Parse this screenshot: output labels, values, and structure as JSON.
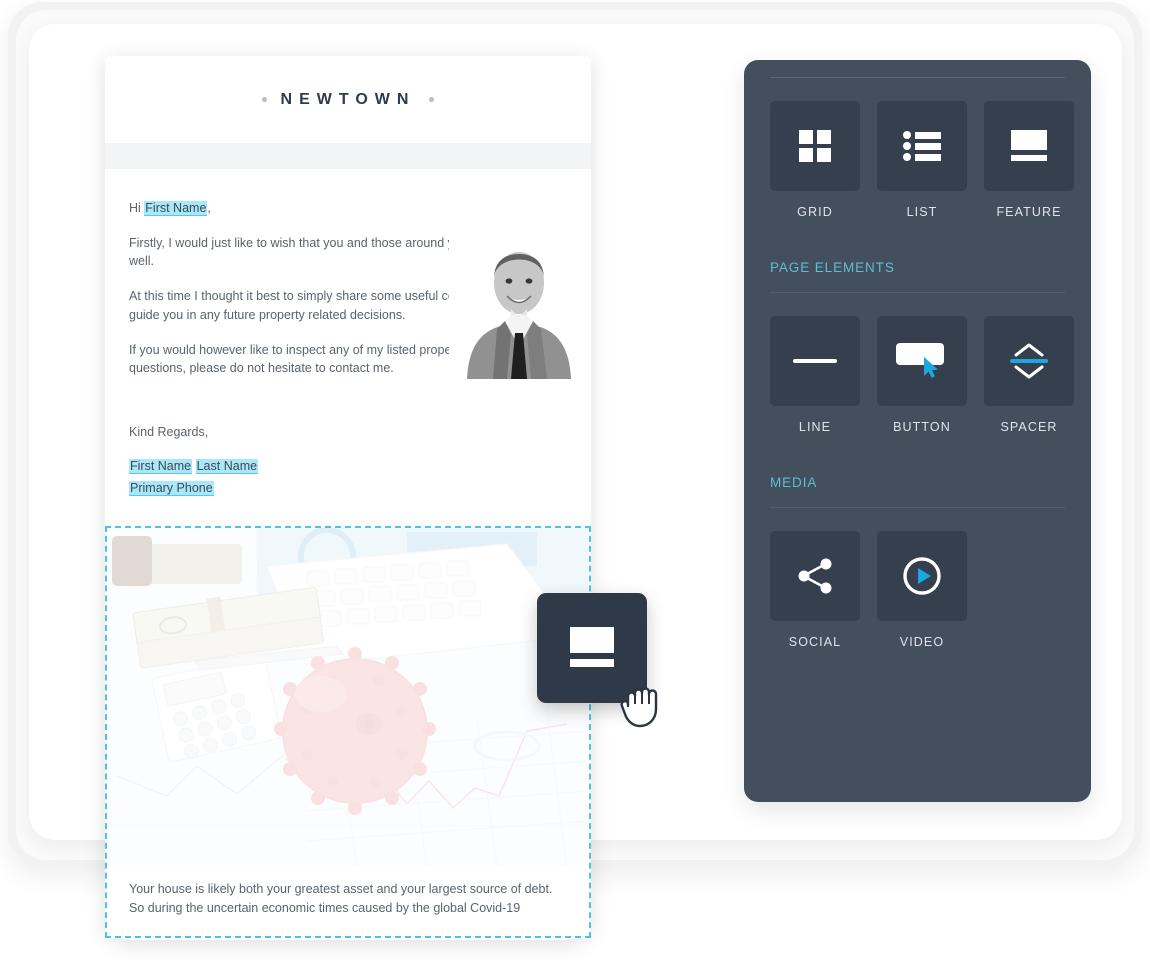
{
  "email": {
    "brand": "NEWTOWN",
    "greeting_prefix": "Hi ",
    "greeting_merge": "First Name",
    "greeting_suffix": ",",
    "paragraphs": [
      "Firstly, I would just like to wish that you and those around you remain safe and well.",
      "At this time I thought it best to simply share some useful content, that can help guide you in any future property related decisions.",
      "If you would however like to inspect any of my listed properties, or have any questions, please do not hesitate to contact me."
    ],
    "signoff": "Kind Regards,",
    "signature": {
      "first_name": "First Name",
      "last_name": "Last Name",
      "primary_phone": "Primary Phone"
    },
    "hero_caption_lines": [
      "Your house is likely both your greatest asset and your largest source of debt.",
      "So during the uncertain economic times caused by the global Covid-19"
    ]
  },
  "panel": {
    "rows": [
      {
        "section": null,
        "tiles": [
          {
            "label": "GRID",
            "icon": "grid-icon"
          },
          {
            "label": "LIST",
            "icon": "list-icon"
          },
          {
            "label": "FEATURE",
            "icon": "feature-icon"
          }
        ]
      },
      {
        "section": "PAGE ELEMENTS",
        "tiles": [
          {
            "label": "LINE",
            "icon": "line-icon"
          },
          {
            "label": "BUTTON",
            "icon": "button-icon"
          },
          {
            "label": "SPACER",
            "icon": "spacer-icon"
          }
        ]
      },
      {
        "section": "MEDIA",
        "tiles": [
          {
            "label": "SOCIAL",
            "icon": "share-icon"
          },
          {
            "label": "VIDEO",
            "icon": "play-circle-icon"
          }
        ]
      }
    ]
  },
  "drag": {
    "element_icon": "feature-icon",
    "cursor": "grab-hand-cursor"
  },
  "colors": {
    "panel_bg": "#444f5e",
    "tile_bg": "#353f4d",
    "accent_cyan": "#4ec3e0",
    "section_heading": "#5fbcd6",
    "merge_tag_bg": "#a9e7fb",
    "body_text": "#5a6370",
    "ghost_bg": "#2f3a49"
  }
}
